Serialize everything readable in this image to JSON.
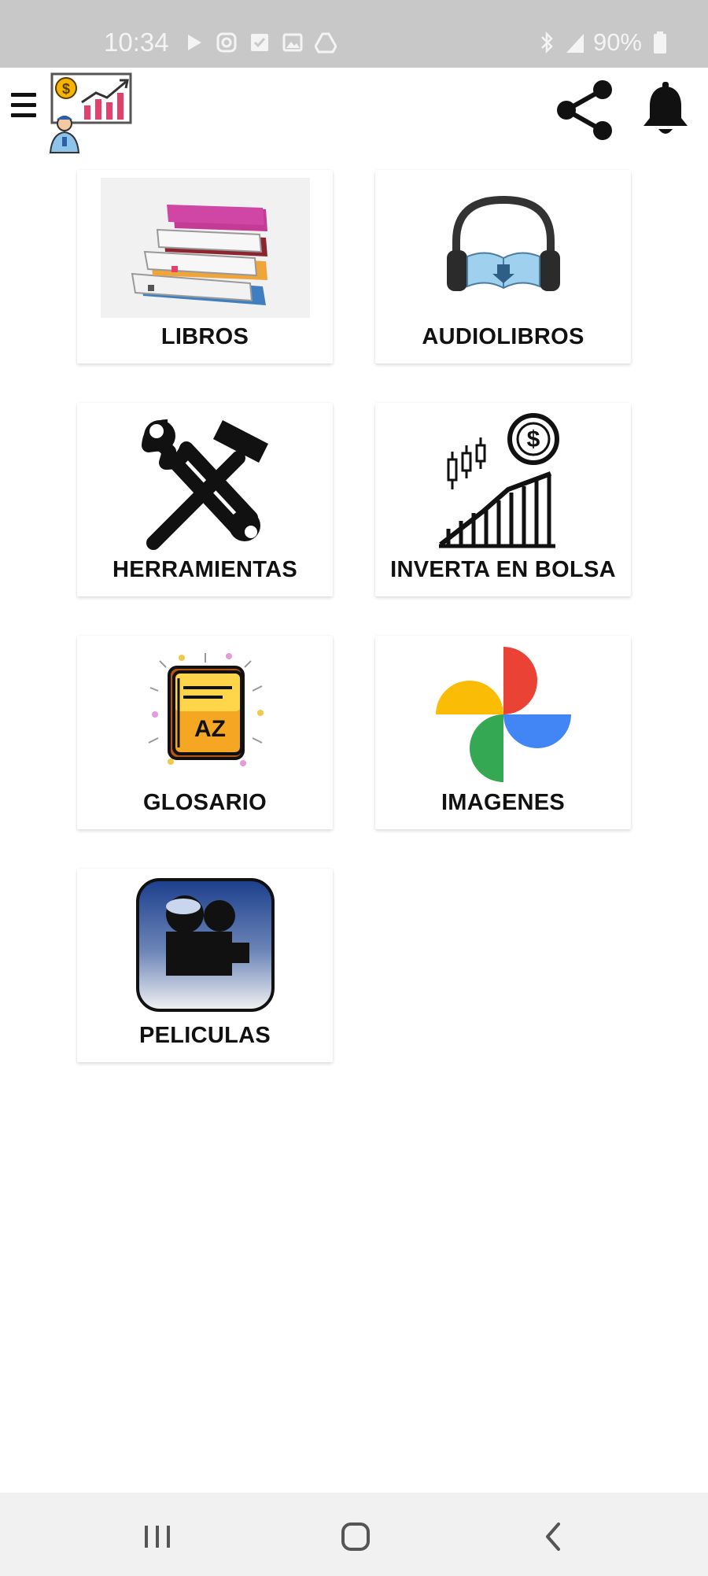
{
  "status_bar": {
    "time": "10:34",
    "battery": "90%",
    "left_icons": [
      "play-icon",
      "instagram-icon",
      "checkbox-icon",
      "gallery-icon",
      "drive-icon"
    ],
    "right_icons": [
      "bluetooth-icon",
      "signal-icon",
      "battery-icon"
    ]
  },
  "app_bar": {
    "menu_icon": "hamburger-icon",
    "logo": "investor-logo",
    "actions": [
      "share-icon",
      "bell-icon"
    ]
  },
  "menu": {
    "items": [
      {
        "label": "LIBROS",
        "icon": "books-icon"
      },
      {
        "label": "AUDIOLIBROS",
        "icon": "headphones-book-icon"
      },
      {
        "label": "HERRAMIENTAS",
        "icon": "tools-icon"
      },
      {
        "label": "INVERTA EN BOLSA",
        "icon": "stock-chart-icon"
      },
      {
        "label": "GLOSARIO",
        "icon": "glossary-book-icon"
      },
      {
        "label": "IMAGENES",
        "icon": "photos-pinwheel-icon"
      },
      {
        "label": "PELICULAS",
        "icon": "movie-camera-icon"
      }
    ]
  },
  "nav_bar": {
    "buttons": [
      "recents-icon",
      "home-icon",
      "back-icon"
    ]
  },
  "colors": {
    "status_bar_bg": "#c8c8c8",
    "nav_bar_bg": "#f1f1f1",
    "label_text": "#111111"
  }
}
